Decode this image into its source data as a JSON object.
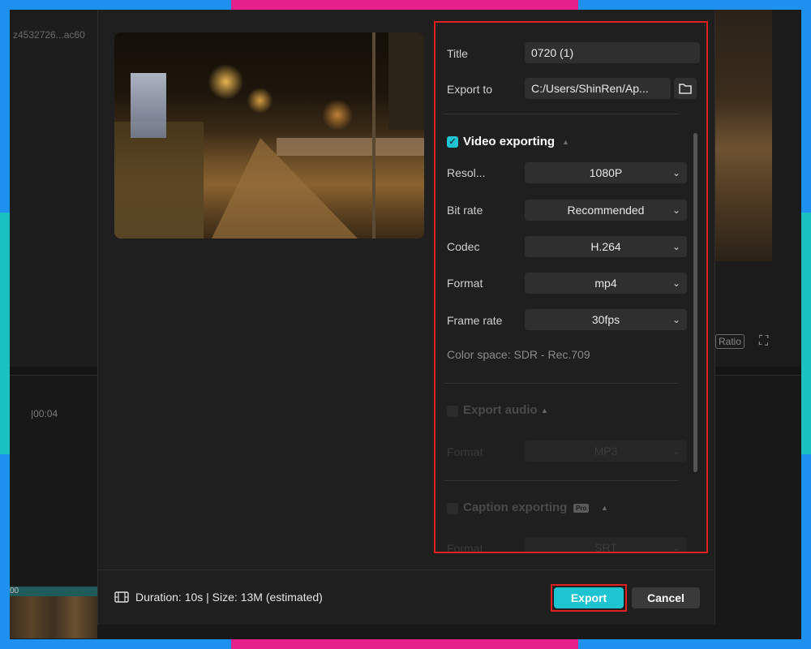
{
  "background": {
    "filename": "z4532726...ac60",
    "timecode": "|00:04",
    "clip_label": "00",
    "ratio_label": "Ratio",
    "fullscreen_icon": "fullscreen-icon"
  },
  "dialog": {
    "title_label": "Title",
    "title_value": "0720 (1)",
    "export_to_label": "Export to",
    "export_to_value": "C:/Users/ShinRen/Ap...",
    "folder_icon": "folder-icon",
    "video": {
      "section_title": "Video exporting",
      "checked": true,
      "resolution_label": "Resol...",
      "resolution_value": "1080P",
      "bitrate_label": "Bit rate",
      "bitrate_value": "Recommended",
      "codec_label": "Codec",
      "codec_value": "H.264",
      "format_label": "Format",
      "format_value": "mp4",
      "framerate_label": "Frame rate",
      "framerate_value": "30fps",
      "color_space": "Color space: SDR - Rec.709"
    },
    "audio": {
      "section_title": "Export audio",
      "checked": false,
      "format_label": "Format",
      "format_value": "MP3"
    },
    "caption": {
      "section_title": "Caption exporting",
      "checked": false,
      "badge": "Pro",
      "format_label": "Format",
      "format_value": "SRT"
    },
    "footer": {
      "duration_text": "Duration: 10s | Size: 13M (estimated)",
      "export_label": "Export",
      "cancel_label": "Cancel"
    }
  },
  "colors": {
    "accent": "#1fc4d2",
    "highlight_border": "#e02020",
    "frame_blue": "#1e90f0",
    "frame_pink": "#e5208c",
    "frame_teal": "#19c2c0"
  }
}
